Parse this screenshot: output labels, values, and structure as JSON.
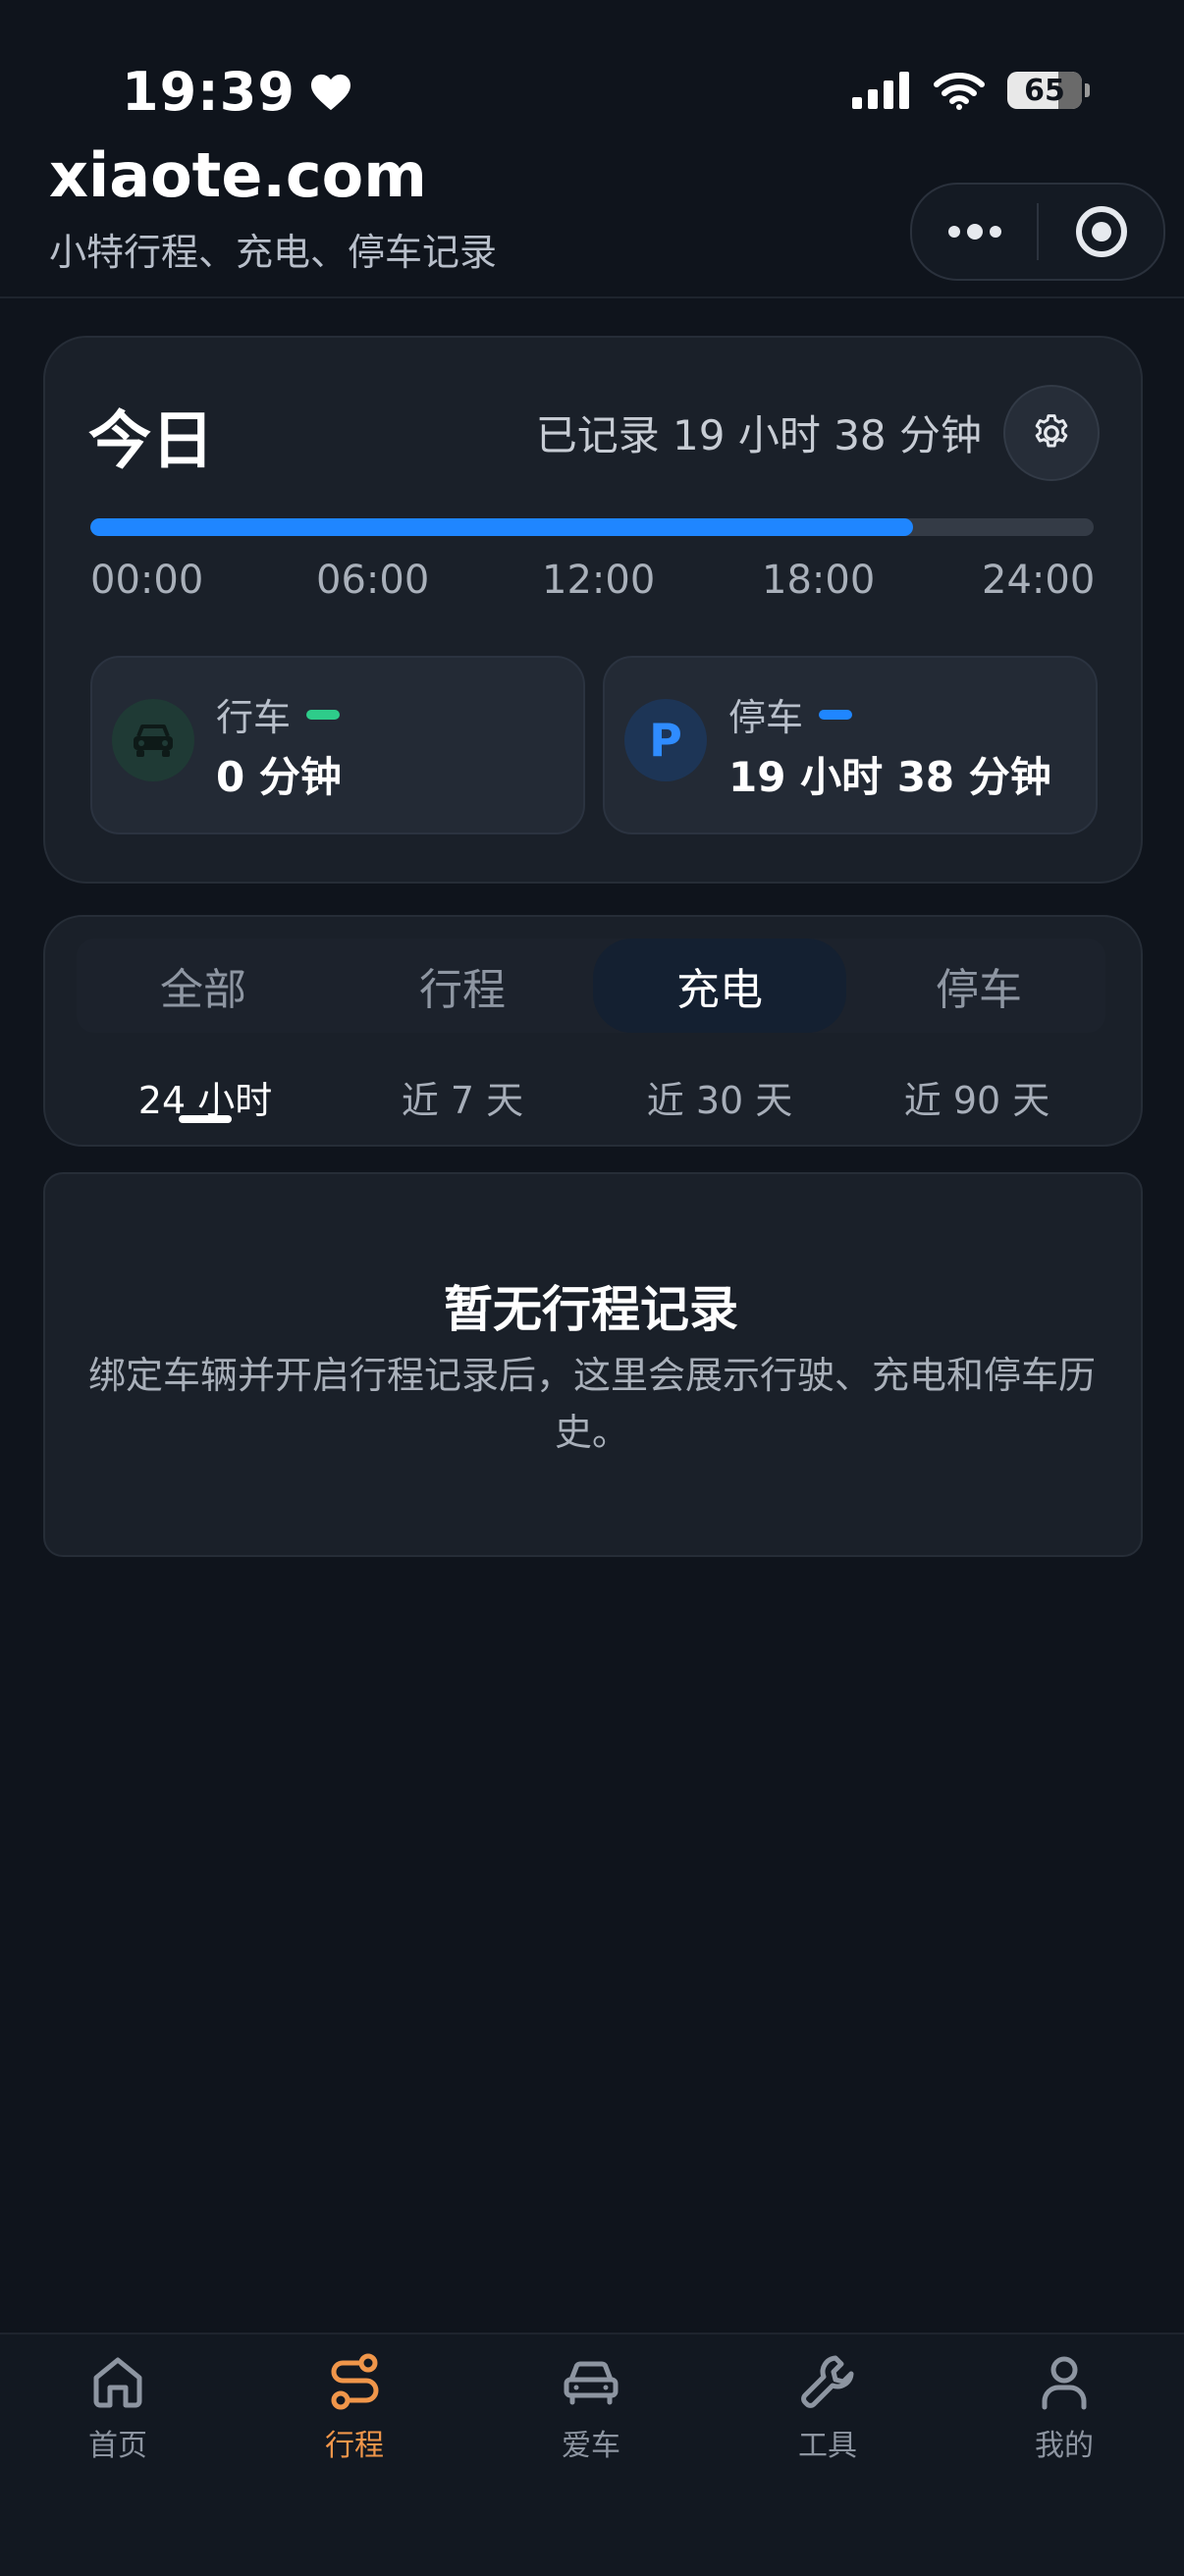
{
  "status_bar": {
    "time": "19:39",
    "battery": "65"
  },
  "header": {
    "title": "xiaote.com",
    "subtitle": "小特行程、充电、停车记录"
  },
  "today": {
    "title": "今日",
    "recorded": "已记录 19 小时 38 分钟",
    "progress": 0.82,
    "ticks": [
      "00:00",
      "06:00",
      "12:00",
      "18:00",
      "24:00"
    ],
    "driving": {
      "label": "行车",
      "value": "0 分钟"
    },
    "parking": {
      "label": "停车",
      "value": "19 小时 38 分钟",
      "icon_letter": "P"
    }
  },
  "tabs": [
    "全部",
    "行程",
    "充电",
    "停车"
  ],
  "active_tab": "充电",
  "ranges": [
    "24 小时",
    "近 7 天",
    "近 30 天",
    "近 90 天"
  ],
  "active_range": "24 小时",
  "empty": {
    "title": "暂无行程记录",
    "description": "绑定车辆并开启行程记录后，这里会展示行驶、充电和停车历史。"
  },
  "nav": [
    {
      "label": "首页",
      "icon": "home-icon"
    },
    {
      "label": "行程",
      "icon": "route-icon",
      "active": true
    },
    {
      "label": "爱车",
      "icon": "car-icon"
    },
    {
      "label": "工具",
      "icon": "wrench-icon"
    },
    {
      "label": "我的",
      "icon": "user-icon"
    }
  ],
  "colors": {
    "accent_blue": "#1f86ff",
    "driving_green": "#2ecc8a",
    "nav_active": "#f0964a"
  }
}
